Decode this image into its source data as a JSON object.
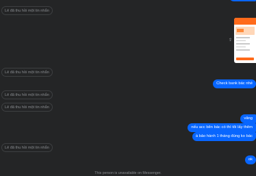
{
  "messages": {
    "recalled_text": "Lê đã thu hồi một tin nhắn",
    "check_bank": "Check bank bác nhé",
    "vang": "vâng",
    "neu_acc": "nếu acc bên bác có thì tôi lấy thêm",
    "bao_hanh": "à bảo hành 1 tháng đúng ko bác",
    "ok": "ok"
  },
  "icons": {
    "share": "share-icon"
  },
  "footer": {
    "unavailable": "This person is unavailable on Messenger."
  },
  "colors": {
    "background": "#242526",
    "outgoing_bubble": "#0866ff",
    "recalled_text": "#8a8d91"
  }
}
